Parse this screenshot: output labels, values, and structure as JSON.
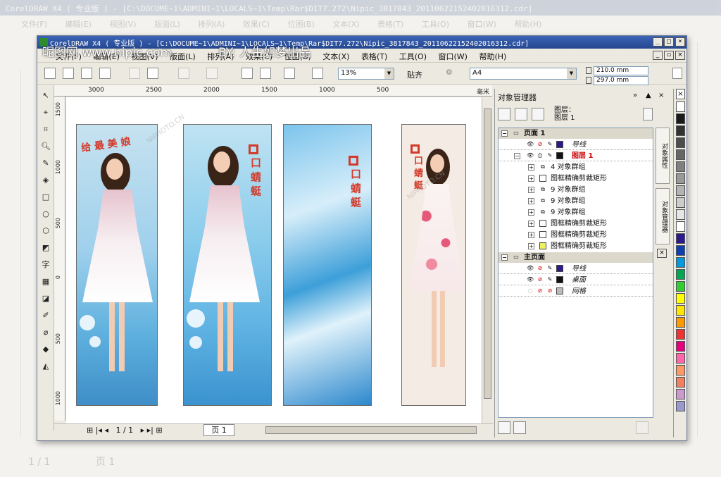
{
  "ghost": {
    "title": "CorelDRAW X4 ( 专业版 ) - [C:\\DOCUME~1\\ADMINI~1\\LOCALS~1\\Temp\\Rar$DIT7.272\\Nipic_3817843_20110622152402016312.cdr]",
    "menus": [
      "文件(F)",
      "编辑(E)",
      "视图(V)",
      "版面(L)",
      "排列(A)",
      "效果(C)",
      "位图(B)",
      "文本(X)",
      "表格(T)",
      "工具(O)",
      "窗口(W)",
      "帮助(H)"
    ],
    "page_count": "1 / 1",
    "page_tab": "页 1"
  },
  "watermark": {
    "site": "昵图网 www.nipic.com",
    "author": "BY: 人生如梦出品",
    "small": "NIPHOTO.CN"
  },
  "window": {
    "title": "CorelDRAW X4 ( 专业版 ) - [C:\\DOCUME~1\\ADMINI~1\\LOCALS~1\\Temp\\Rar$DIT7.272\\Nipic_3817843_20110622152402016312.cdr]",
    "buttons": [
      "_",
      "□",
      "×"
    ],
    "doc_buttons": [
      "_",
      "▫",
      "×"
    ]
  },
  "menu": [
    "文件(F)",
    "编辑(E)",
    "视图(V)",
    "版面(L)",
    "排列(A)",
    "效果(C)",
    "位图(B)",
    "文本(X)",
    "表格(T)",
    "工具(O)",
    "窗口(W)",
    "帮助(H)"
  ],
  "toolbar": {
    "zoom": "13%",
    "snap": "贴齐",
    "page_size": "A4",
    "width": "210.0 mm",
    "height": "297.0 mm"
  },
  "hruler": [
    "3000",
    "2500",
    "2000",
    "1500",
    "1000",
    "500",
    "毫米"
  ],
  "vruler": [
    "1500",
    "1000",
    "500",
    "0",
    "500",
    "1000"
  ],
  "canvas": {
    "panel1_text": "给 最 美 娘",
    "panel2_text": "口 蜻 蜓",
    "panel3_text": "口 蜻 蜓",
    "panel4_text": "口 蜻 蜓"
  },
  "statusbar": {
    "page_count": "1 / 1",
    "page_tab": "页 1"
  },
  "docker": {
    "title": "对象管理器",
    "layer_label_1": "图层：",
    "layer_label_2": "图层 1",
    "rows": [
      {
        "label": "页面 1",
        "type": "header"
      },
      {
        "label": "导线",
        "type": "layer"
      },
      {
        "label": "图层 1",
        "type": "layer-active"
      },
      {
        "label": "4 对象群组",
        "type": "item",
        "icon": "group"
      },
      {
        "label": "图框精确剪裁矩形",
        "type": "item",
        "icon": "rect"
      },
      {
        "label": "9 对象群组",
        "type": "item",
        "icon": "group"
      },
      {
        "label": "9 对象群组",
        "type": "item",
        "icon": "group"
      },
      {
        "label": "9 对象群组",
        "type": "item",
        "icon": "group"
      },
      {
        "label": "图框精确剪裁矩形",
        "type": "item",
        "icon": "rect"
      },
      {
        "label": "图框精确剪裁矩形",
        "type": "item",
        "icon": "rect"
      },
      {
        "label": "图框精确剪裁矩形",
        "type": "item",
        "icon": "yellow"
      },
      {
        "label": "主页面",
        "type": "header"
      },
      {
        "label": "导线",
        "type": "layer"
      },
      {
        "label": "桌面",
        "type": "layer"
      },
      {
        "label": "网格",
        "type": "layer"
      }
    ],
    "side_tabs": [
      "对象属性",
      "对象管理器"
    ]
  },
  "palette": [
    "#ffffff",
    "#1a1a1a",
    "#333333",
    "#4d4d4d",
    "#666666",
    "#808080",
    "#999999",
    "#b3b3b3",
    "#cccccc",
    "#e6e6e6",
    "#ffffff",
    "#2a1a8c",
    "#0d3fb0",
    "#0099dd",
    "#00a651",
    "#33cc33",
    "#ffff00",
    "#ffe600",
    "#ff9900",
    "#ee3333",
    "#e6007e",
    "#ff66aa",
    "#ff9966",
    "#f08060",
    "#cc99cc",
    "#9999cc"
  ],
  "colors": {
    "title_blue": "#24478f",
    "panel_border": "#6a6a6a",
    "logo_red": "#d23a2a"
  }
}
